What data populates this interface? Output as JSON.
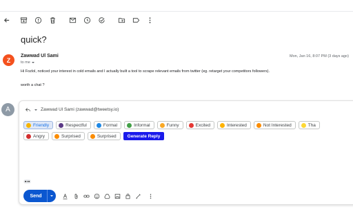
{
  "toolbar": {
    "icons": [
      "back-arrow-icon",
      "archive-icon",
      "report-spam-icon",
      "delete-icon",
      "mark-unread-icon",
      "snooze-icon",
      "add-task-icon",
      "move-to-icon",
      "label-icon",
      "more-vert-icon"
    ]
  },
  "email": {
    "subject": "quick?",
    "sender_initial": "Z",
    "sender_name": "Zawwad Ul Sami",
    "to_label": "to me",
    "date": "Mon, Jan 16, 8:07 PM (3 days ago)",
    "body_line1": "Hi Fozlol, noticed your interest in cold emails and I actually built a tool to scrape relevant emails from twitter (eg. retarget your competitors followers).",
    "body_line2": "worth a chat ?"
  },
  "compose": {
    "user_initial": "A",
    "recipient": "Zawwad Ul Sami (zawwad@tweetsy.io)",
    "tones_row1": [
      {
        "label": "Friendly",
        "color": "#f6b400",
        "active": true
      },
      {
        "label": "Respectful",
        "color": "#5b3a86"
      },
      {
        "label": "Formal",
        "color": "#1e88e5"
      },
      {
        "label": "Informal",
        "color": "#43a047"
      },
      {
        "label": "Funny",
        "color": "#f9a825"
      },
      {
        "label": "Excited",
        "color": "#e53935"
      },
      {
        "label": "Interested",
        "color": "#ffb300"
      },
      {
        "label": "Not Interested",
        "color": "#fb8c00"
      },
      {
        "label": "Tha",
        "color": "#fdd835"
      }
    ],
    "tones_row2": [
      {
        "label": "Angry",
        "color": "#d32f2f"
      },
      {
        "label": "Surprised",
        "color": "#fb8c00"
      },
      {
        "label": "Surprised",
        "color": "#fb8c00"
      }
    ],
    "generate_label": "Generate Reply",
    "send_label": "Send",
    "format_icons": [
      "text-format-icon",
      "attach-icon",
      "link-icon",
      "emoji-icon",
      "drive-icon",
      "photo-icon",
      "lock-icon",
      "signature-icon",
      "more-vert-icon"
    ]
  },
  "colors": {
    "accent": "#0b57d0",
    "generate": "#1a1aeb",
    "sender_avatar": "#f4511e",
    "user_avatar": "#8e9aa6"
  }
}
